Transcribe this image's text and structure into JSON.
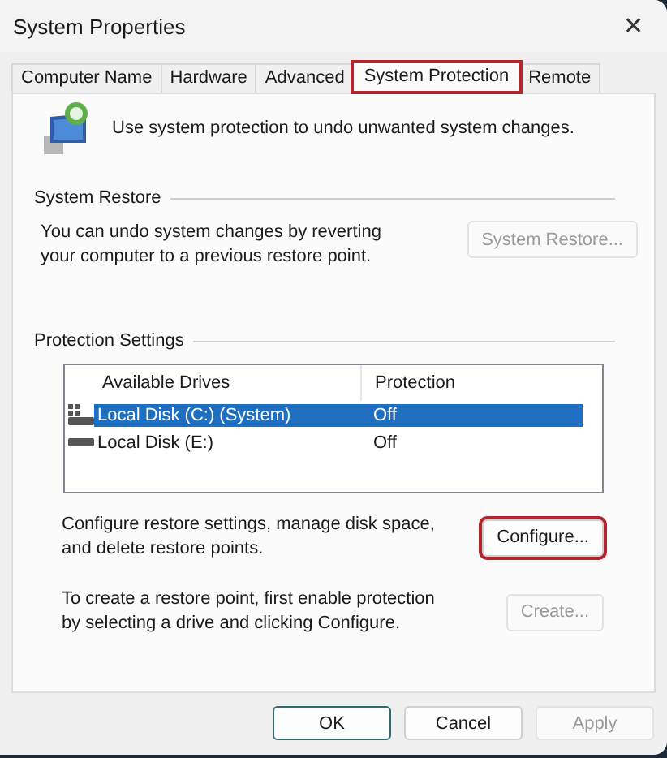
{
  "window": {
    "title": "System Properties",
    "close": "✕"
  },
  "tabs": [
    {
      "label": "Computer Name",
      "selected": false,
      "highlighted": false
    },
    {
      "label": "Hardware",
      "selected": false,
      "highlighted": false
    },
    {
      "label": "Advanced",
      "selected": false,
      "highlighted": false
    },
    {
      "label": "System Protection",
      "selected": true,
      "highlighted": true
    },
    {
      "label": "Remote",
      "selected": false,
      "highlighted": false
    }
  ],
  "intro": "Use system protection to undo unwanted system changes.",
  "system_restore": {
    "title": "System Restore",
    "text": "You can undo system changes by reverting your computer to a previous restore point.",
    "button": {
      "label": "System Restore...",
      "disabled": true,
      "highlighted": false
    }
  },
  "protection_settings": {
    "title": "Protection Settings",
    "columns": [
      "Available Drives",
      "Protection"
    ],
    "rows": [
      {
        "drive": "Local Disk (C:) (System)",
        "protection": "Off",
        "kind": "system",
        "selected": true
      },
      {
        "drive": "Local Disk (E:)",
        "protection": "Off",
        "kind": "disk",
        "selected": false
      }
    ],
    "configure": {
      "text": "Configure restore settings, manage disk space, and delete restore points.",
      "button": {
        "label": "Configure...",
        "disabled": false,
        "highlighted": true
      }
    },
    "create": {
      "text": "To create a restore point, first enable protection by selecting a drive and clicking Configure.",
      "button": {
        "label": "Create...",
        "disabled": true,
        "highlighted": false
      }
    }
  },
  "buttons": [
    {
      "label": "OK",
      "default": true,
      "disabled": false
    },
    {
      "label": "Cancel",
      "default": false,
      "disabled": false
    },
    {
      "label": "Apply",
      "default": false,
      "disabled": true
    }
  ]
}
